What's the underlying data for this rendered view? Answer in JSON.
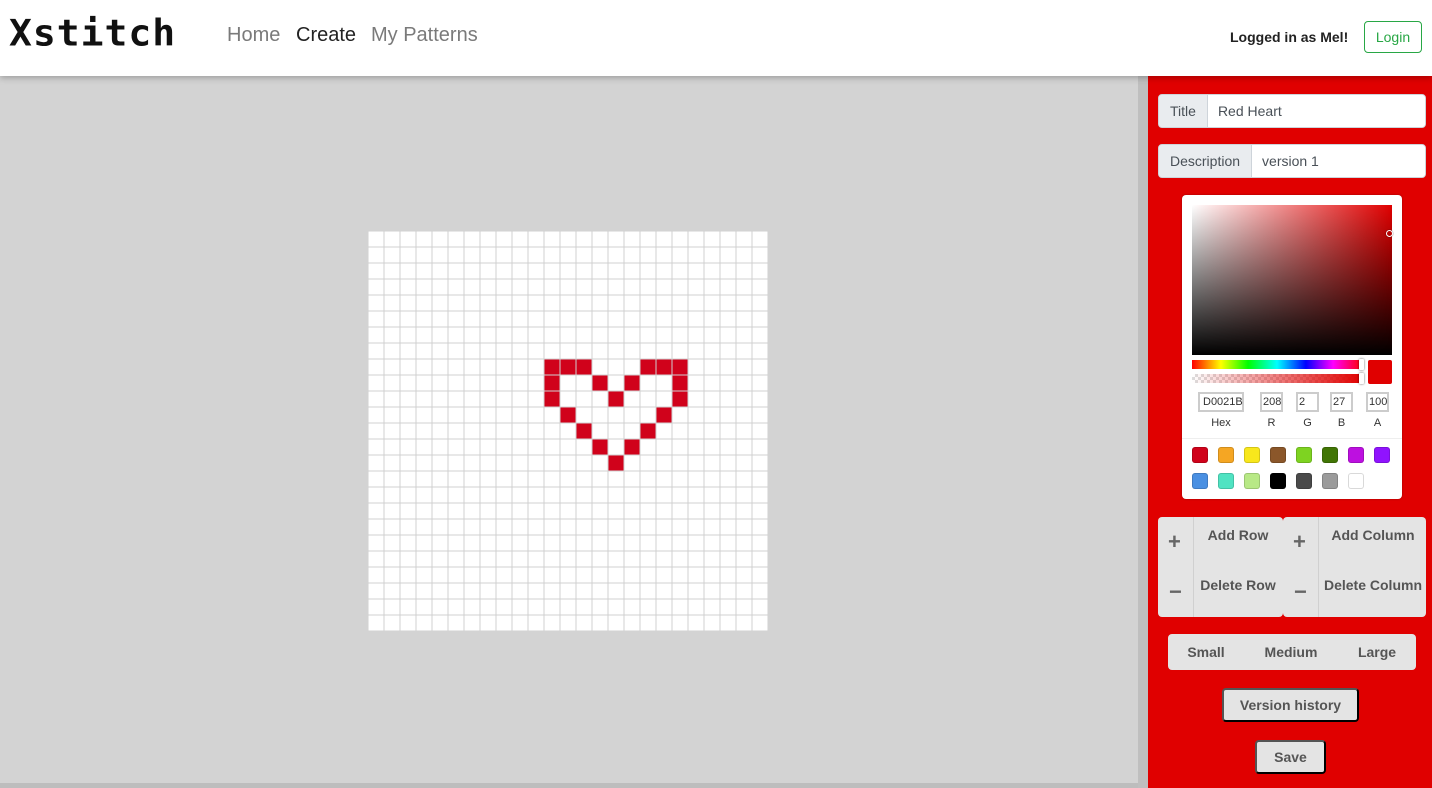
{
  "navbar": {
    "logo": "Xstitch",
    "links": [
      "Home",
      "Create",
      "My Patterns"
    ],
    "active": "Create",
    "logged_in_text": "Logged in as Mel!",
    "login_label": "Login"
  },
  "pattern": {
    "title_label": "Title",
    "title_value": "Red Heart",
    "description_label": "Description",
    "description_value": "version 1",
    "grid_size": 25,
    "stitch_color": "#d0021b",
    "filled_cells": [
      [
        8,
        11
      ],
      [
        8,
        12
      ],
      [
        8,
        13
      ],
      [
        8,
        17
      ],
      [
        8,
        18
      ],
      [
        8,
        19
      ],
      [
        9,
        11
      ],
      [
        9,
        14
      ],
      [
        9,
        16
      ],
      [
        9,
        19
      ],
      [
        10,
        11
      ],
      [
        10,
        15
      ],
      [
        10,
        19
      ],
      [
        11,
        12
      ],
      [
        11,
        18
      ],
      [
        12,
        13
      ],
      [
        12,
        17
      ],
      [
        13,
        14
      ],
      [
        13,
        16
      ],
      [
        14,
        15
      ]
    ]
  },
  "color_picker": {
    "current_color": "#e00000",
    "hex": "D0021B",
    "r": "208",
    "g": "2",
    "b": "27",
    "a": "100",
    "labels": {
      "hex": "Hex",
      "r": "R",
      "g": "G",
      "b": "B",
      "a": "A"
    },
    "presets": [
      "#D0021B",
      "#F5A623",
      "#F8E71C",
      "#8B572A",
      "#7ED321",
      "#417505",
      "#BD10E0",
      "#9013FE",
      "#4A90E2",
      "#50E3C2",
      "#B8E986",
      "#000000",
      "#4A4A4A",
      "#9B9B9B",
      "#FFFFFF"
    ]
  },
  "controls": {
    "add_row": "Add Row",
    "delete_row": "Delete Row",
    "add_column": "Add Column",
    "delete_column": "Delete Column",
    "plus_symbol": "+",
    "minus_symbol": "−",
    "sizes": [
      "Small",
      "Medium",
      "Large"
    ],
    "version_history": "Version history",
    "save": "Save"
  },
  "colors": {
    "panel_bg": "#e00000",
    "canvas_bg": "#d3d3d3",
    "login_green": "#28a745"
  }
}
